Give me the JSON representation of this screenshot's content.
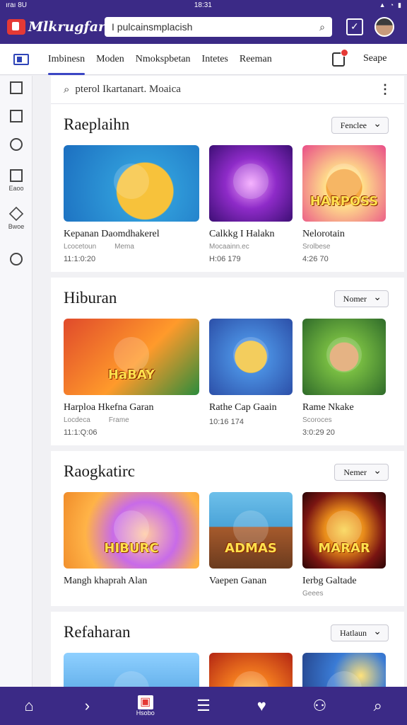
{
  "status": {
    "left": "ıraı 8U",
    "time": "18:31"
  },
  "app": {
    "name": "Mlkrugfar"
  },
  "top_search": {
    "text": "I pulcainsmplacish"
  },
  "tabs": [
    "Imbinesn",
    "Moden",
    "Nmokspbetan",
    "Intetes",
    "Reeman"
  ],
  "tabs_right": "Seape",
  "search": {
    "text": "pterol Ikartanart. Moaica"
  },
  "rail": [
    {
      "icon": "home-icon",
      "label": ""
    },
    {
      "icon": "document-icon",
      "label": ""
    },
    {
      "icon": "compass-icon",
      "label": ""
    },
    {
      "icon": "edit-icon",
      "label": "Eaoo"
    },
    {
      "icon": "diamond-icon",
      "label": "Bwoe"
    },
    {
      "icon": "heart-icon",
      "label": ""
    }
  ],
  "sections": [
    {
      "title": "Raeplaihn",
      "filter": "Fenclee",
      "cards": [
        {
          "title": "Kepanan  Daomdhakerel",
          "sub": "Lcocetoun",
          "sub2": "Mema",
          "meta": "11:1:0:20",
          "thumb": "yellow",
          "thumb_label": ""
        },
        {
          "title": "Calkkg I Halakn",
          "sub": "Mocaainn.ec",
          "meta": "H:06 179",
          "thumb": "purple",
          "thumb_label": ""
        },
        {
          "title": "Nelorotain",
          "sub": "Srolbese",
          "meta": "4:26 70",
          "thumb": "fox",
          "thumb_label": "HARPOSS"
        }
      ]
    },
    {
      "title": "Hiburan",
      "filter": "Nomer",
      "cards": [
        {
          "title": "Harploa  Hkefna Garan",
          "sub": "Locdeca",
          "sub2": "Frame",
          "meta": "11:1:Q:06",
          "thumb": "red",
          "thumb_label": "HaBAY"
        },
        {
          "title": "Rathe Cap Gaain",
          "sub": "",
          "meta": "10:16 174",
          "thumb": "blue",
          "thumb_label": ""
        },
        {
          "title": "Rame Nkake",
          "sub": "Scoroces",
          "meta": "3:0:29 20",
          "thumb": "green",
          "thumb_label": ""
        }
      ]
    },
    {
      "title": "Raogkatirc",
      "filter": "Nemer",
      "cards": [
        {
          "title": "Mangh khaprah Alan",
          "sub": "",
          "meta": "",
          "thumb": "candy",
          "thumb_label": "HIBURC"
        },
        {
          "title": "Vaepen Ganan",
          "sub": "",
          "meta": "",
          "thumb": "war",
          "thumb_label": "ADMAS"
        },
        {
          "title": "Ierbg Galtade",
          "sub": "Geees",
          "meta": "",
          "thumb": "gold",
          "thumb_label": "MARAR"
        }
      ]
    },
    {
      "title": "Refaharan",
      "filter": "Hatlaun",
      "cards": [
        {
          "title": "",
          "sub": "",
          "meta": "",
          "thumb": "sky",
          "thumb_label": ""
        },
        {
          "title": "",
          "sub": "",
          "meta": "",
          "thumb": "fire",
          "thumb_label": ""
        },
        {
          "title": "",
          "sub": "",
          "meta": "",
          "thumb": "night",
          "thumb_label": ""
        }
      ]
    }
  ],
  "bottom_nav": [
    {
      "icon": "home-icon",
      "glyph": "⌂",
      "label": ""
    },
    {
      "icon": "arrow-icon",
      "glyph": "›",
      "label": ""
    },
    {
      "icon": "store-icon",
      "glyph": "▣",
      "label": "Hsobo",
      "active": true
    },
    {
      "icon": "menu-icon",
      "glyph": "☰",
      "label": ""
    },
    {
      "icon": "heart-icon",
      "glyph": "♥",
      "label": ""
    },
    {
      "icon": "profile-icon",
      "glyph": "⚇",
      "label": ""
    },
    {
      "icon": "search-icon",
      "glyph": "⌕",
      "label": ""
    }
  ],
  "colors": {
    "brand": "#3b2a86",
    "accent": "#e53935",
    "tab_indicator": "#3b46c4"
  }
}
